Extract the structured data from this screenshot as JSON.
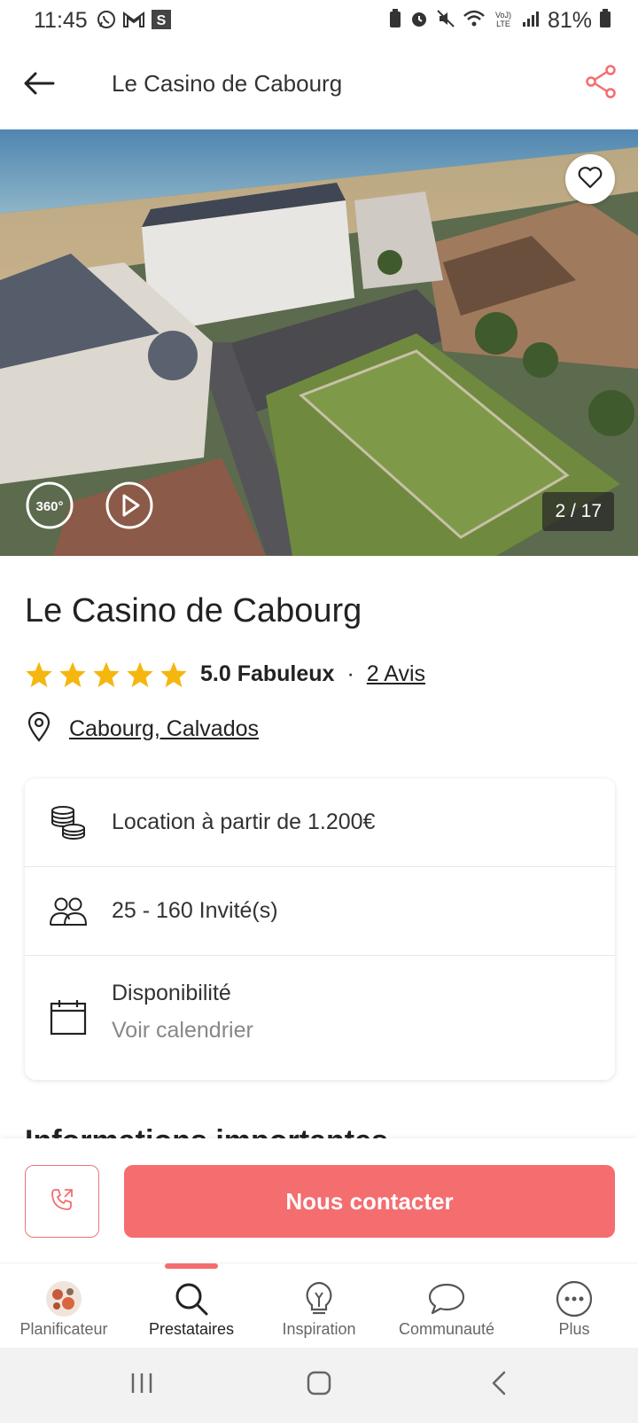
{
  "status_bar": {
    "time": "11:45",
    "battery_percent": "81%",
    "icons": [
      "whatsapp-icon",
      "gmail-icon",
      "s-icon",
      "battery-saver-icon",
      "alarm-icon",
      "mute-icon",
      "wifi-icon",
      "volte-icon",
      "signal-icon",
      "battery-icon"
    ]
  },
  "header": {
    "title": "Le Casino de Cabourg",
    "back_icon": "arrow-left-icon",
    "share_icon": "share-icon"
  },
  "hero": {
    "counter": "2 / 17",
    "label_360": "360°",
    "favorite_icon": "heart-icon"
  },
  "venue": {
    "title": "Le Casino de Cabourg",
    "stars": 5,
    "rating_text": "5.0 Fabuleux",
    "separator": "·",
    "reviews_link": "2 Avis",
    "location": "Cabourg, Calvados"
  },
  "info_card": {
    "price": "Location à partir de 1.200€",
    "guests": "25 - 160 Invité(s)",
    "availability_title": "Disponibilité",
    "availability_link": "Voir calendrier"
  },
  "section_heading_partial": "Informations importantes",
  "contact": {
    "button_label": "Nous contacter"
  },
  "bottom_nav": {
    "items": [
      {
        "label": "Planificateur"
      },
      {
        "label": "Prestataires"
      },
      {
        "label": "Inspiration"
      },
      {
        "label": "Communauté"
      },
      {
        "label": "Plus"
      }
    ],
    "active_index": 1
  },
  "colors": {
    "accent": "#f46d6f",
    "star": "#f5b70f"
  }
}
